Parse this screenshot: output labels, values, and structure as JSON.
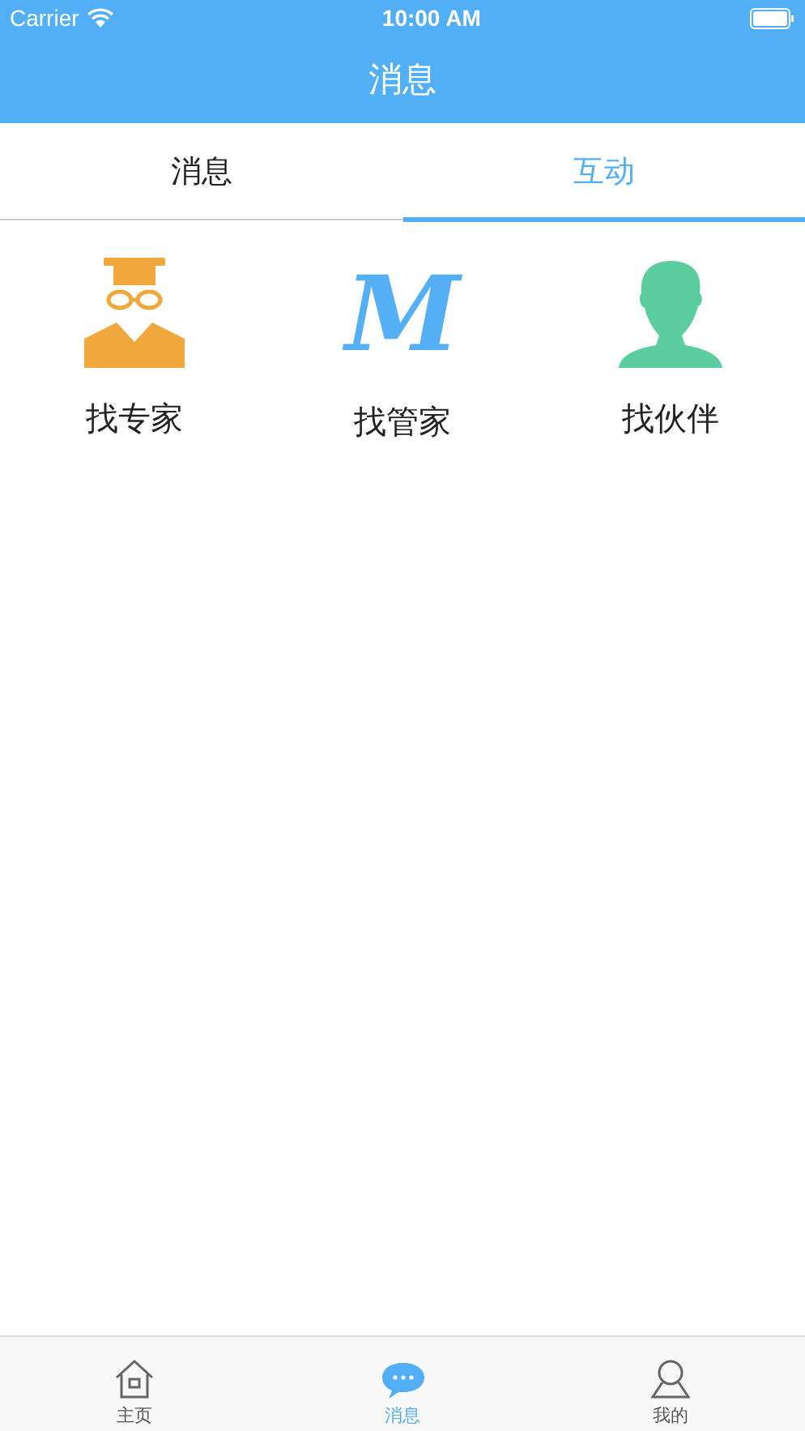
{
  "status_bar": {
    "carrier": "Carrier",
    "time": "10:00 AM"
  },
  "nav": {
    "title": "消息"
  },
  "tabs": [
    {
      "label": "消息",
      "selected": false
    },
    {
      "label": "互动",
      "selected": true
    }
  ],
  "items": [
    {
      "label": "找专家",
      "kind": "expert",
      "color": "#f0a73c"
    },
    {
      "label": "找管家",
      "kind": "letter",
      "glyph": "M",
      "color": "#55aff5"
    },
    {
      "label": "找伙伴",
      "kind": "person",
      "color": "#5ccd9e"
    }
  ],
  "tab_bar": [
    {
      "label": "主页",
      "kind": "home",
      "selected": false
    },
    {
      "label": "消息",
      "kind": "chat",
      "selected": true
    },
    {
      "label": "我的",
      "kind": "user",
      "selected": false
    }
  ]
}
